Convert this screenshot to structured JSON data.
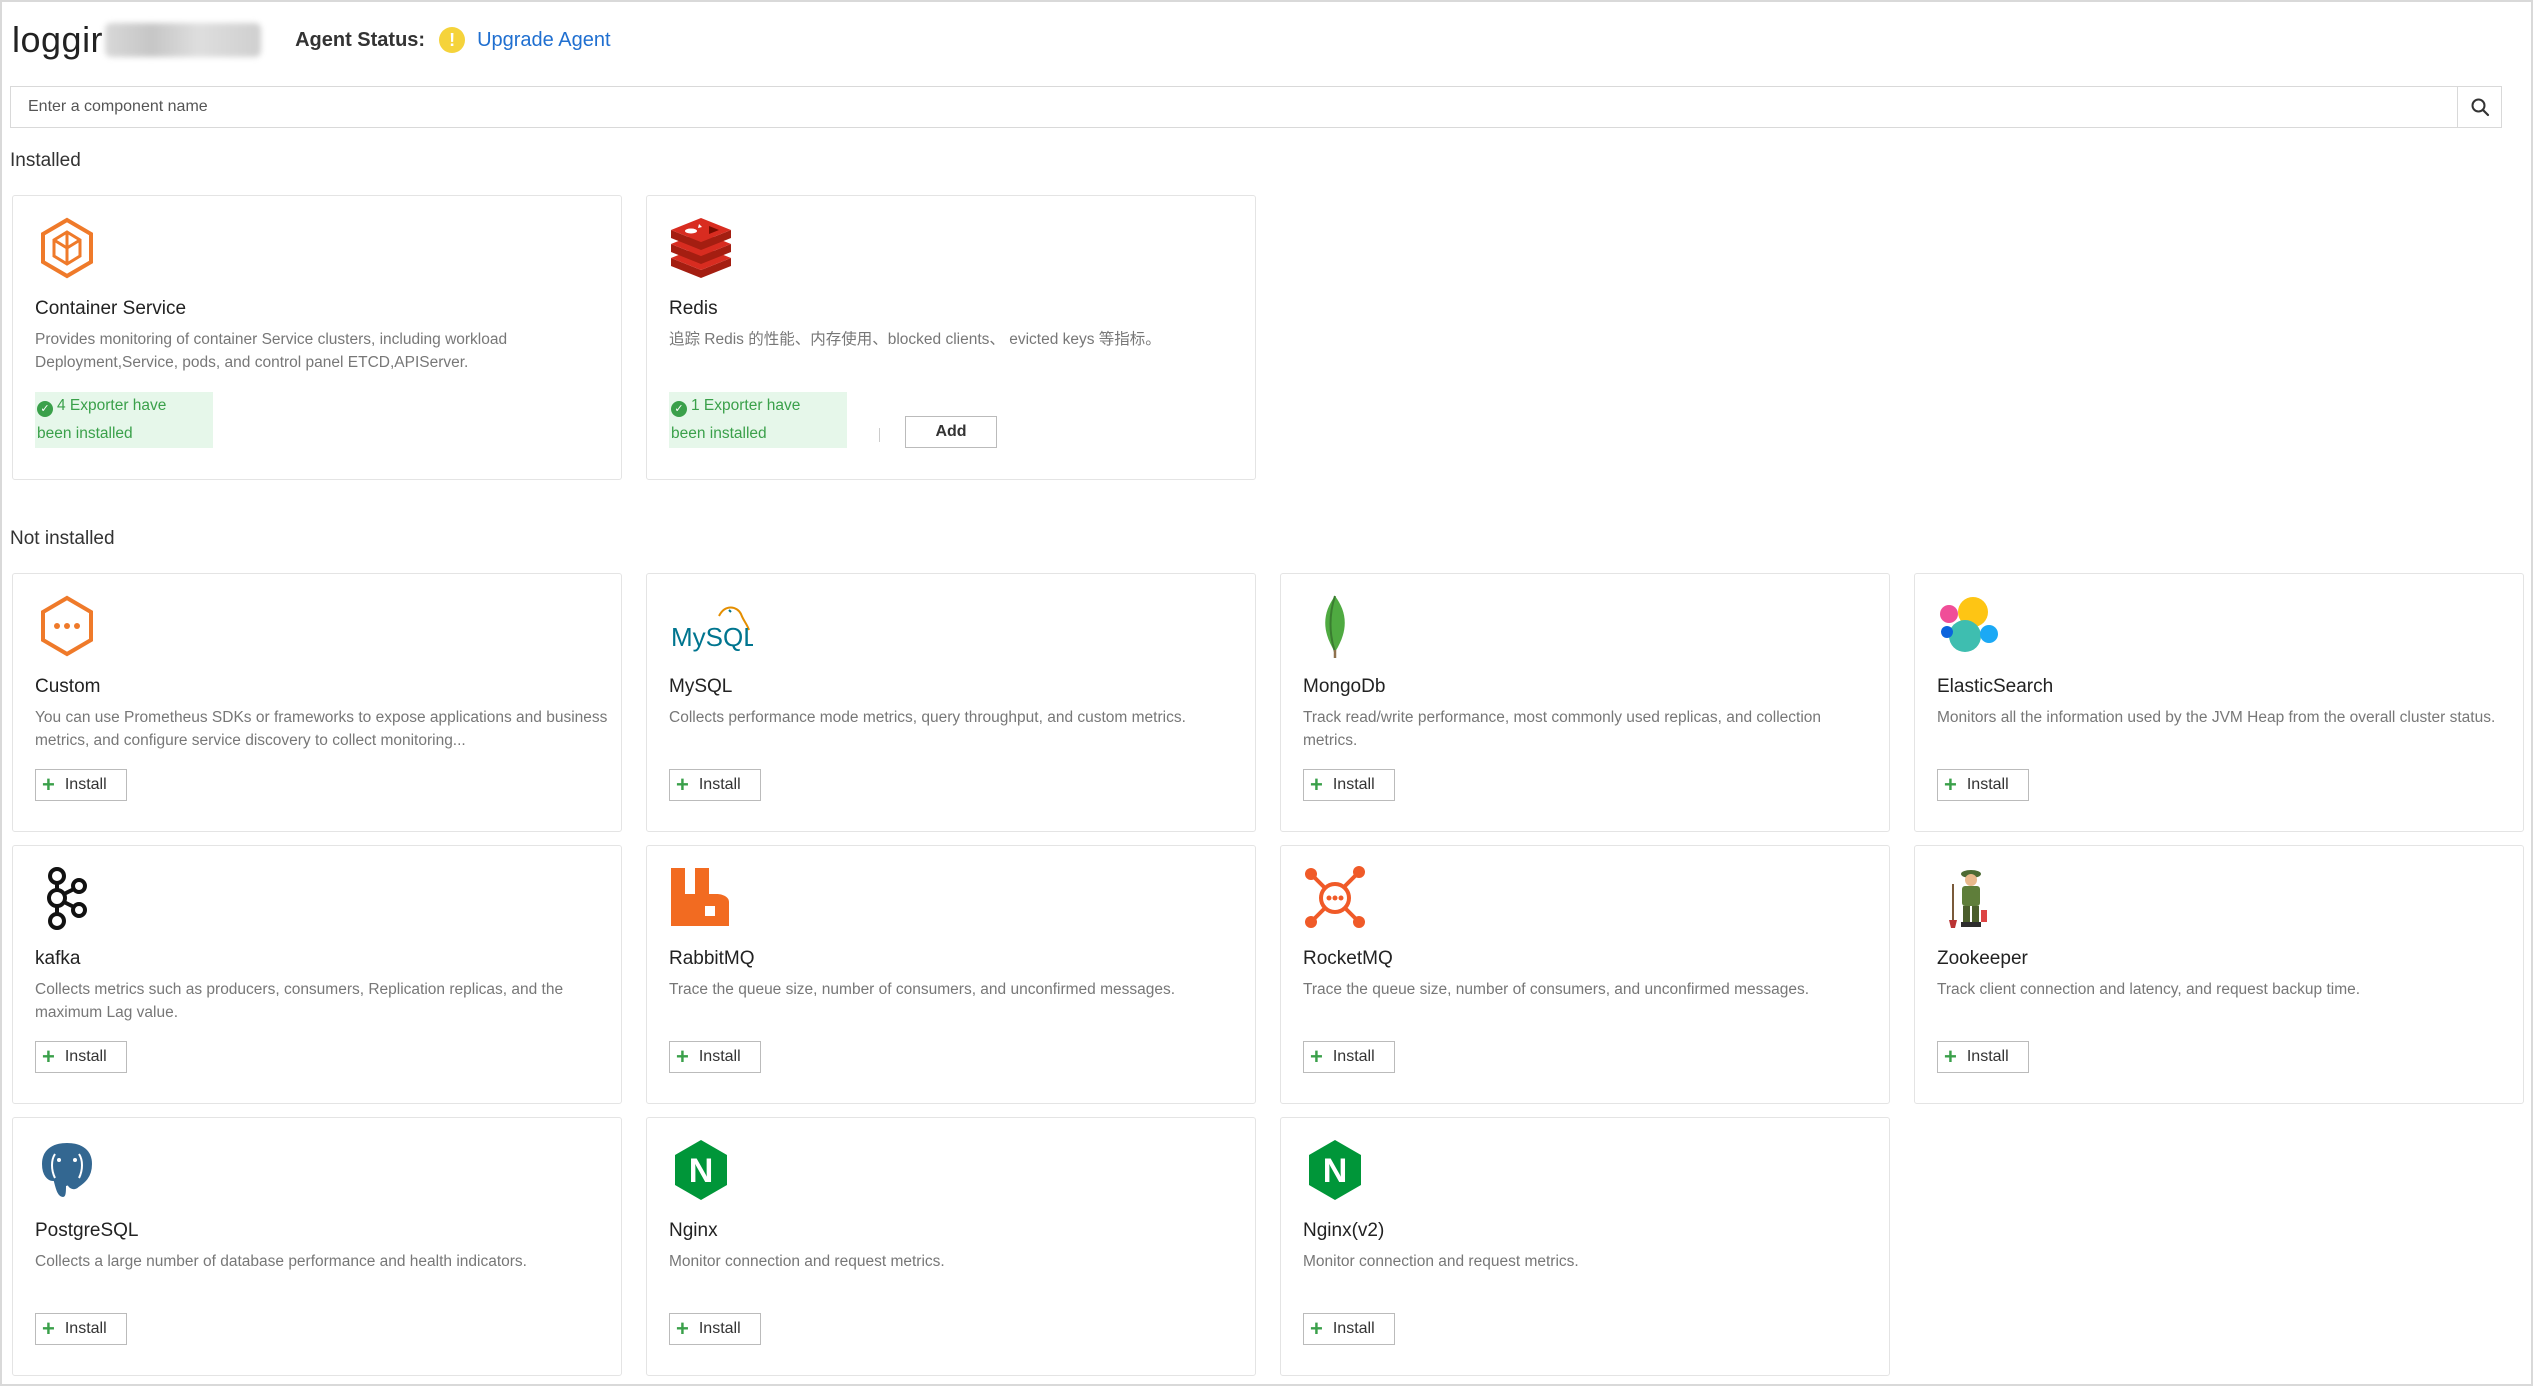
{
  "header": {
    "title": "loggir",
    "agent_status_label": "Agent Status:",
    "status_icon_glyph": "!",
    "upgrade_link": "Upgrade Agent"
  },
  "search": {
    "placeholder": "Enter a component name",
    "icon": "search-icon"
  },
  "sections": {
    "installed": "Installed",
    "not_installed": "Not installed"
  },
  "installed": [
    {
      "name": "Container Service",
      "description": "Provides monitoring of container Service clusters, including workload Deployment,Service, pods, and control panel ETCD,APIServer.",
      "badge_line1": "4 Exporter have",
      "badge_line2": "been installed",
      "icon": "container-service-icon"
    },
    {
      "name": "Redis",
      "description": "追踪 Redis 的性能、内存使用、blocked clients、 evicted keys 等指标。",
      "badge_line1": "1 Exporter have",
      "badge_line2": "been installed",
      "add_label": "Add",
      "icon": "redis-icon"
    }
  ],
  "not_installed": [
    {
      "name": "Custom",
      "description": "You can use Prometheus SDKs or frameworks to expose applications and business metrics, and configure service discovery to collect monitoring...",
      "install_label": "Install",
      "icon": "custom-icon"
    },
    {
      "name": "MySQL",
      "description": "Collects performance mode metrics, query throughput, and custom metrics.",
      "install_label": "Install",
      "icon": "mysql-icon",
      "logo_text": "MySQL"
    },
    {
      "name": "MongoDb",
      "description": "Track read/write performance, most commonly used replicas, and collection metrics.",
      "install_label": "Install",
      "icon": "mongodb-icon"
    },
    {
      "name": "ElasticSearch",
      "description": "Monitors all the information used by the JVM Heap from the overall cluster status.",
      "install_label": "Install",
      "icon": "elasticsearch-icon"
    },
    {
      "name": "kafka",
      "description": "Collects metrics such as producers, consumers, Replication replicas, and the maximum Lag value.",
      "install_label": "Install",
      "icon": "kafka-icon"
    },
    {
      "name": "RabbitMQ",
      "description": "Trace the queue size, number of consumers, and unconfirmed messages.",
      "install_label": "Install",
      "icon": "rabbitmq-icon"
    },
    {
      "name": "RocketMQ",
      "description": "Trace the queue size, number of consumers, and unconfirmed messages.",
      "install_label": "Install",
      "icon": "rocketmq-icon"
    },
    {
      "name": "Zookeeper",
      "description": "Track client connection and latency, and request backup time.",
      "install_label": "Install",
      "icon": "zookeeper-icon"
    },
    {
      "name": "PostgreSQL",
      "description": "Collects a large number of database performance and health indicators.",
      "install_label": "Install",
      "icon": "postgresql-icon"
    },
    {
      "name": "Nginx",
      "description": "Monitor connection and request metrics.",
      "install_label": "Install",
      "icon": "nginx-icon",
      "logo_text": "N"
    },
    {
      "name": "Nginx(v2)",
      "description": "Monitor connection and request metrics.",
      "install_label": "Install",
      "icon": "nginx-v2-icon",
      "logo_text": "N"
    }
  ],
  "colors": {
    "link": "#1f6fd0",
    "success": "#3aa04a",
    "success_bg": "#e6f7ea",
    "warning": "#f5d33b"
  }
}
